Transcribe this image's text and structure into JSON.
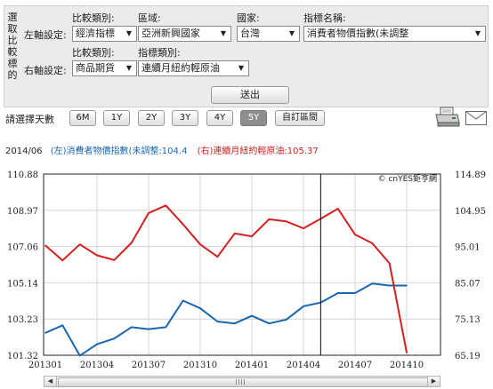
{
  "selector": {
    "side_title": "選取比較標的",
    "left_axis_label": "左軸設定:",
    "right_axis_label": "右軸設定:",
    "hdr_compare_type": "比較類別:",
    "hdr_region": "區域:",
    "hdr_country": "國家:",
    "hdr_indicator_name": "指標名稱:",
    "hdr_compare_type_right": "比較類別:",
    "hdr_indicator_type": "指標類別:",
    "left_compare_type": "經濟指標",
    "left_region": "亞洲新興國家",
    "left_country": "台灣",
    "left_indicator": "消費者物價指數(未調整",
    "right_compare_type": "商品期貨",
    "right_indicator_type": "連續月紐約輕原油",
    "send_label": "送出"
  },
  "range": {
    "label": "請選擇天數",
    "buttons": [
      "6M",
      "1Y",
      "2Y",
      "3Y",
      "4Y",
      "5Y",
      "自訂區間"
    ],
    "active_index": 5
  },
  "info": {
    "date": "2014/06",
    "left_text": "(左)消費者物價指數(未調整:104.4",
    "right_text": "(右)連續月紐約輕原油:105.37"
  },
  "chart_data": {
    "type": "line",
    "watermark": "© cnYES鉅亨網",
    "left_ticks": [
      "110.88",
      "108.97",
      "107.06",
      "105.14",
      "103.23",
      "101.32"
    ],
    "right_ticks": [
      "114.89",
      "104.95",
      "95.01",
      "85.07",
      "75.13",
      "65.19"
    ],
    "x_ticks": [
      "201301",
      "201304",
      "201307",
      "201310",
      "201401",
      "201404",
      "201407",
      "201410"
    ],
    "left_range": [
      101.32,
      110.88
    ],
    "right_range": [
      65.19,
      114.89
    ],
    "x": [
      "201301",
      "201302",
      "201303",
      "201304",
      "201305",
      "201306",
      "201307",
      "201308",
      "201309",
      "201310",
      "201311",
      "201312",
      "201401",
      "201402",
      "201403",
      "201404",
      "201405",
      "201406",
      "201407",
      "201408",
      "201409",
      "201410"
    ],
    "cursor_x": "201405",
    "series": [
      {
        "name": "(左)消費者物價指數(未調整",
        "axis": "left",
        "color": "#1a66b0",
        "values": [
          102.5,
          102.9,
          101.3,
          101.9,
          102.2,
          102.8,
          102.7,
          102.8,
          104.2,
          103.8,
          103.1,
          103.0,
          103.4,
          103.0,
          103.2,
          103.9,
          104.1,
          104.6,
          104.6,
          105.1,
          105.0,
          105.0
        ]
      },
      {
        "name": "(右)連續月紐約輕原油",
        "axis": "right",
        "color": "#d42020",
        "values": [
          95.3,
          91.2,
          95.6,
          92.6,
          91.3,
          96.0,
          104.2,
          106.3,
          101.1,
          95.6,
          92.2,
          98.6,
          97.8,
          102.5,
          101.9,
          100.0,
          102.6,
          105.4,
          98.3,
          95.9,
          90.4,
          65.9
        ]
      }
    ]
  }
}
